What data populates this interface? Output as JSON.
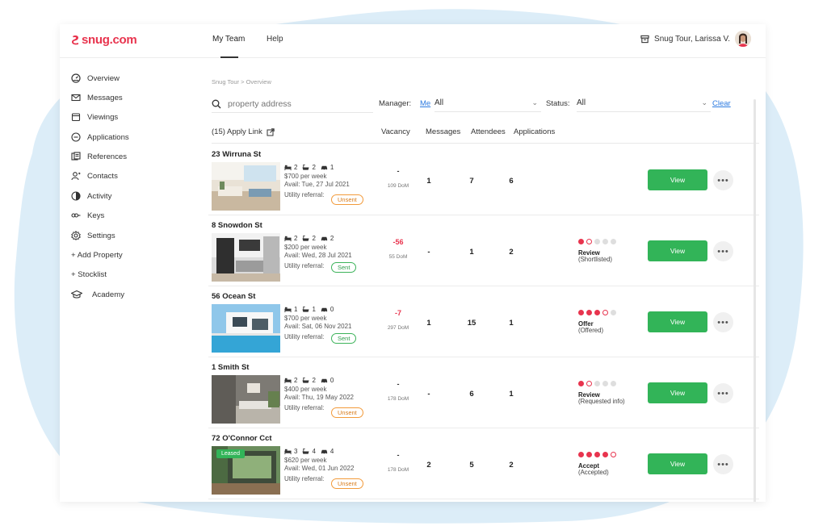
{
  "app": {
    "logo": "snug.com",
    "brand_color": "#e8344e",
    "nav_tabs": [
      "My Team",
      "Help"
    ],
    "user_label": "Snug Tour,  Larissa V."
  },
  "sidebar": {
    "items": [
      {
        "label": "Overview",
        "icon": "dashboard-icon"
      },
      {
        "label": "Messages",
        "icon": "mail-icon"
      },
      {
        "label": "Viewings",
        "icon": "calendar-icon"
      },
      {
        "label": "Applications",
        "icon": "applications-icon"
      },
      {
        "label": "References",
        "icon": "references-icon"
      },
      {
        "label": "Contacts",
        "icon": "contacts-icon"
      },
      {
        "label": "Activity",
        "icon": "activity-icon"
      },
      {
        "label": "Keys",
        "icon": "key-icon"
      },
      {
        "label": "Settings",
        "icon": "gear-icon"
      },
      {
        "label": "+ Add Property",
        "icon": ""
      },
      {
        "label": "+ Stocklist",
        "icon": ""
      },
      {
        "label": "Academy",
        "icon": "graduation-cap-icon"
      }
    ]
  },
  "main": {
    "breadcrumb": "Snug Tour > Overview",
    "search_placeholder": "property address",
    "manager_label": "Manager:",
    "manager_me": "Me",
    "manager_value": "All",
    "status_label": "Status:",
    "status_value": "All",
    "clear_label": "Clear",
    "apply_link": "(15) Apply Link",
    "columns": [
      "Vacancy",
      "Messages",
      "Attendees",
      "Applications"
    ]
  },
  "rows": [
    {
      "title": "23 Wirruna St",
      "beds": "2",
      "baths": "2",
      "cars": "1",
      "price": "$700 per week",
      "avail": "Avail: Tue, 27 Jul 2021",
      "utility_label": "Utility referral:",
      "utility_status": "Unsent",
      "vacancy": "-",
      "dom": "109 DoM",
      "messages": "1",
      "attendees": "7",
      "applications": "6",
      "stage": "",
      "substage": "",
      "progress_filled": 0,
      "progress_ring": false,
      "leased": "",
      "view": "View",
      "more": "•••"
    },
    {
      "title": "8 Snowdon St",
      "beds": "2",
      "baths": "2",
      "cars": "2",
      "price": "$200 per week",
      "avail": "Avail: Wed, 28 Jul 2021",
      "utility_label": "Utility referral:",
      "utility_status": "Sent",
      "vacancy": "-56",
      "dom": "55 DoM",
      "messages": "-",
      "attendees": "1",
      "applications": "2",
      "stage": "Review",
      "substage": "(Shortlisted)",
      "progress_filled": 1,
      "progress_ring": true,
      "leased": "",
      "view": "View",
      "more": "•••"
    },
    {
      "title": "56 Ocean St",
      "beds": "1",
      "baths": "1",
      "cars": "0",
      "price": "$700 per week",
      "avail": "Avail: Sat, 06 Nov 2021",
      "utility_label": "Utility referral:",
      "utility_status": "Sent",
      "vacancy": "-7",
      "dom": "297 DoM",
      "messages": "1",
      "attendees": "15",
      "applications": "1",
      "stage": "Offer",
      "substage": "(Offered)",
      "progress_filled": 3,
      "progress_ring": true,
      "leased": "",
      "view": "View",
      "more": "•••"
    },
    {
      "title": "1 Smith St",
      "beds": "2",
      "baths": "2",
      "cars": "0",
      "price": "$400 per week",
      "avail": "Avail: Thu, 19 May 2022",
      "utility_label": "Utility referral:",
      "utility_status": "Unsent",
      "vacancy": "-",
      "dom": "178 DoM",
      "messages": "-",
      "attendees": "6",
      "applications": "1",
      "stage": "Review",
      "substage": "(Requested info)",
      "progress_filled": 1,
      "progress_ring": true,
      "leased": "",
      "view": "View",
      "more": "•••"
    },
    {
      "title": "72 O'Connor Cct",
      "beds": "3",
      "baths": "4",
      "cars": "4",
      "price": "$620 per week",
      "avail": "Avail: Wed, 01 Jun 2022",
      "utility_label": "Utility referral:",
      "utility_status": "Unsent",
      "vacancy": "-",
      "dom": "178 DoM",
      "messages": "2",
      "attendees": "5",
      "applications": "2",
      "stage": "Accept",
      "substage": "(Accepted)",
      "progress_filled": 4,
      "progress_ring": true,
      "leased": "Leased",
      "view": "View",
      "more": "•••"
    }
  ]
}
